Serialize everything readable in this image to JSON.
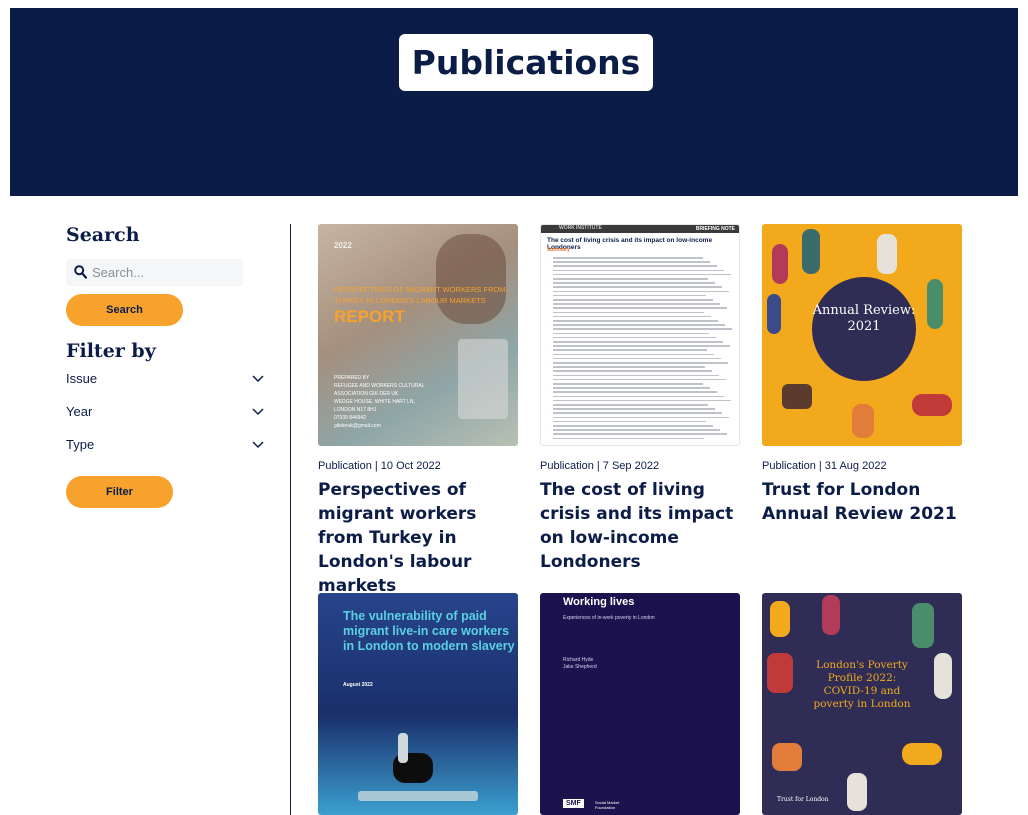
{
  "header": {
    "title": "Publications"
  },
  "sidebar": {
    "search_heading": "Search",
    "search_placeholder": "Search...",
    "search_button": "Search",
    "filter_heading": "Filter by",
    "filters": [
      "Issue",
      "Year",
      "Type"
    ],
    "filter_button": "Filter"
  },
  "cards": [
    {
      "meta": "Publication | 10 Oct 2022",
      "title": "Perspectives of migrant workers from Turkey in London's labour markets",
      "thumb": {
        "year": "2022",
        "cover_title": "Perspectives of migrant workers from Turkey in London's labour markets",
        "big": "REPORT",
        "details": "PREPARED BY\nREFUGEE AND WORKERS CULTURAL ASSOCIATION GIK-DER UK\nWEDGE HOUSE, WHITE HART LN, LONDON N17 8HJ\n07939 844942\ngikderuk@gmail.com"
      }
    },
    {
      "meta": "Publication | 7 Sep 2022",
      "title": "The cost of living crisis and its impact on low-income Londoners",
      "thumb": {
        "banner": "BRIEFING NOTE",
        "org": "WORK INSTITUTE",
        "heading": "The cost of living crisis and its impact on low-income Londoners",
        "section": "Summary"
      }
    },
    {
      "meta": "Publication | 31 Aug 2022",
      "title": "Trust for London Annual Review 2021",
      "thumb": {
        "circle_text": "Annual Review: 2021"
      }
    },
    {
      "meta": "",
      "title": "",
      "thumb": {
        "cover_title": "The vulnerability of paid migrant live-in care workers in London to modern slavery",
        "date": "August 2022"
      }
    },
    {
      "meta": "",
      "title": "",
      "thumb": {
        "cover_title": "Working lives",
        "subtitle": "Experiences of in-work poverty in London",
        "authors": "Richard Hyde\nJake Shepherd",
        "logo": "SMF",
        "logo_sub": "Social Market Foundation"
      }
    },
    {
      "meta": "",
      "title": "",
      "thumb": {
        "cover_title": "London's Poverty Profile 2022: COVID-19 and poverty in London",
        "brand": "Trust for London"
      }
    }
  ],
  "colors": {
    "navy": "#0b1c47",
    "orange": "#f6a22d",
    "purple": "#2f2d56"
  }
}
